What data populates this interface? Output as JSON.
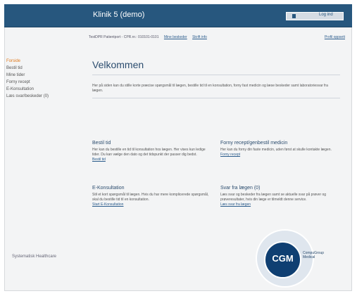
{
  "header": {
    "title": "Klinik 5 (demo)",
    "login_label": "Log ind"
  },
  "infobar": {
    "text": "TestDPR Patientport - CPR.nr.: 010101-0101",
    "link1": "Mine beskeder",
    "link2": "Skrift info",
    "right_link": "Profil oppsett"
  },
  "sidebar": {
    "items": [
      {
        "label": "Forside"
      },
      {
        "label": "Bestil tid"
      },
      {
        "label": "Mine tider"
      },
      {
        "label": "Forny recept"
      },
      {
        "label": "E-Konsultation"
      },
      {
        "label": "Læs svar/beskeder (0)"
      }
    ]
  },
  "main": {
    "title": "Velkommen",
    "intro": "Her på siden kan du stille korte præcise spørgsmål til lægen, bestille tid til en konsultation, forny fast medicin og læse beskeder samt laboratoriesvar fra lægen."
  },
  "cards": [
    {
      "title": "Bestil tid",
      "body": "Her kan du bestille en tid til konsultation hos lægen. Her vises kun ledige tider. Du kan vælge den dato og det tidspunkt der passer dig bedst.",
      "link": "Bestil tid"
    },
    {
      "title": "Forny recept/genbestil medicin",
      "body": "Her kan du forny din faste medicin, uden først at skulle kontakte lægen.",
      "link": "Forny recept"
    },
    {
      "title": "E-Konsultation",
      "body": "Stil et kort spørgsmål til lægen. Hvis du har mere komplicerede spørgsmål, skal du bestille tid til en konsultation.",
      "link": "Start E-Konsultation"
    },
    {
      "title": "Svar fra lægen (0)",
      "body": "Læs svar og beskeder fra lægen samt se aktuelle svar på prøver og prøveresultater, hvis din læge er tilmeldt denne service.",
      "link": "Læs svar fra lægen"
    }
  ],
  "footer": {
    "left": "Systematisk Healthcare",
    "logo_text": "CGM",
    "brand_line1": "CompuGroup",
    "brand_line2": "Medical"
  },
  "colors": {
    "header_bg": "#27577e",
    "accent_orange": "#e07a1c",
    "link_blue": "#2b5c8c",
    "logo_blue": "#0f3f72"
  }
}
